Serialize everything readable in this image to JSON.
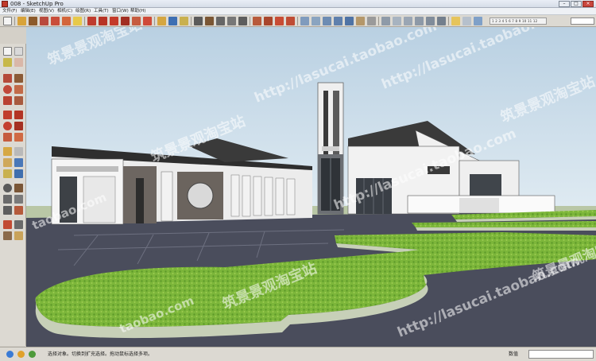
{
  "window": {
    "title": "008 - SketchUp Pro",
    "controls": {
      "minimize": "–",
      "maximize": "□",
      "close": "×"
    }
  },
  "menu": {
    "items": [
      "文件(F)",
      "编辑(E)",
      "视图(V)",
      "相机(C)",
      "绘图(R)",
      "工具(T)",
      "窗口(W)",
      "帮助(H)"
    ]
  },
  "toolbar": {
    "shadow_scale": "1 2 3 4 5 6 7 8 9 10 11 12",
    "shadow_label": "",
    "icons": [
      "select-icon",
      "line-icon",
      "arc-icon",
      "rectangle-icon",
      "push-pull-icon",
      "move-icon",
      "rotate-icon",
      "scale-icon",
      "orbit-icon",
      "pan-icon",
      "zoom-icon",
      "zoom-extents-icon",
      "iso-view-icon",
      "top-view-icon",
      "front-view-icon",
      "right-view-icon",
      "back-view-icon",
      "left-view-icon",
      "xray-icon",
      "wireframe-icon",
      "hidden-line-icon",
      "shaded-icon",
      "textured-icon",
      "monochrome-icon",
      "shadows-icon",
      "fog-icon"
    ]
  },
  "left_toolbar": {
    "icons": [
      "select-icon",
      "component-icon",
      "paint-bucket-icon",
      "eraser-icon",
      "rectangle-icon",
      "line-icon",
      "circle-icon",
      "arc-icon",
      "polygon-icon",
      "freehand-icon",
      "move-icon",
      "push-pull-icon",
      "rotate-icon",
      "follow-me-icon",
      "scale-icon",
      "offset-icon",
      "tape-measure-icon",
      "dimension-icon",
      "protractor-icon",
      "text-icon",
      "axes-icon",
      "3d-text-icon",
      "orbit-icon",
      "pan-icon",
      "zoom-icon",
      "zoom-window-icon",
      "zoom-extents-icon",
      "previous-view-icon",
      "position-camera-icon",
      "look-around-icon",
      "walk-icon",
      "section-plane-icon"
    ]
  },
  "watermarks": [
    "筑景景观淘宝站",
    "http://lasucai.taobao.com",
    "筑景景观淘宝站",
    "http://lasucai.taobao.com",
    "筑景景观淘宝站",
    "http://lasucai.taobao.com",
    "taobao.com",
    "taobao.com",
    "筑景景观淘宝站",
    "http://lasucai.taobao.com",
    "筑景景观淘宝站"
  ],
  "status": {
    "text": "选择对象。切换到扩充选择。拖动鼠标选择多项。",
    "measure_label": "数值",
    "measure_value": ""
  },
  "colors": {
    "sky": "#c9dcea",
    "ground": "#4a4d5c",
    "lawn": "#7eb83a",
    "hedge_side": "#c7d0b8",
    "building": "#f2f2f2",
    "roof": "#3a3a3a"
  }
}
